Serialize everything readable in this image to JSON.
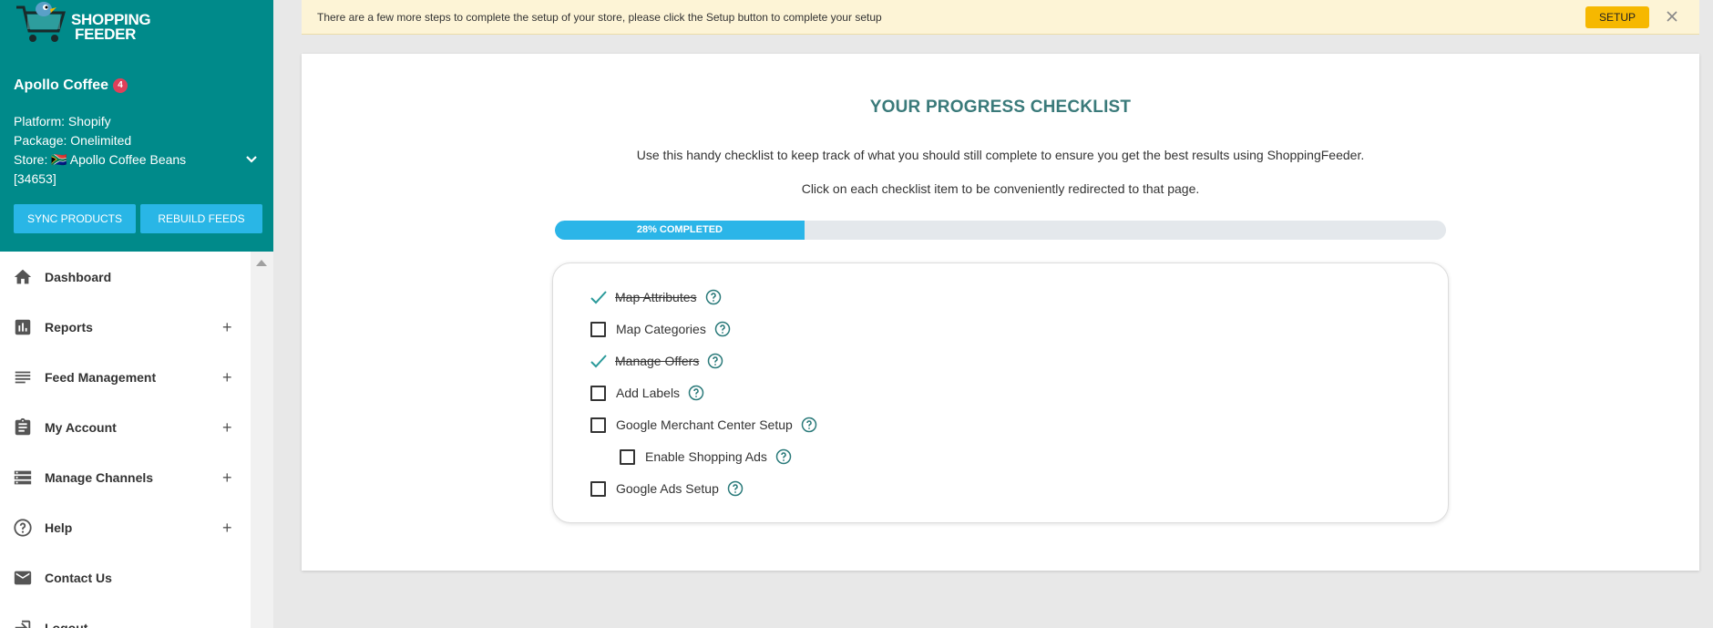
{
  "logo": {
    "line1": "SHOPPING",
    "line2": "FEEDER"
  },
  "store": {
    "name": "Apollo Coffee",
    "notifications": "4",
    "platform": "Platform: Shopify",
    "package": "Package: Onelimited",
    "store_line1": "Store: 🇿🇦 Apollo Coffee Beans",
    "store_line2": "[34653]"
  },
  "buttons": {
    "sync": "SYNC PRODUCTS",
    "rebuild": "REBUILD FEEDS"
  },
  "menu": [
    {
      "label": "Dashboard",
      "icon": "home-icon",
      "expandable": false
    },
    {
      "label": "Reports",
      "icon": "bar-chart-icon",
      "expandable": true
    },
    {
      "label": "Feed Management",
      "icon": "list-icon",
      "expandable": true
    },
    {
      "label": "My Account",
      "icon": "clipboard-icon",
      "expandable": true
    },
    {
      "label": "Manage Channels",
      "icon": "storage-icon",
      "expandable": true
    },
    {
      "label": "Help",
      "icon": "help-circle-icon",
      "expandable": true
    },
    {
      "label": "Contact Us",
      "icon": "mail-icon",
      "expandable": false
    },
    {
      "label": "Logout",
      "icon": "logout-icon",
      "expandable": false
    }
  ],
  "menu_plus": "+",
  "alert": {
    "text": "There are a few more steps to complete the setup of your store, please click the Setup button to complete your setup",
    "button": "SETUP"
  },
  "checklist": {
    "title": "YOUR PROGRESS CHECKLIST",
    "desc1": "Use this handy checklist to keep track of what you should still complete to ensure you get the best results using ShoppingFeeder.",
    "desc2": "Click on each checklist item to be conveniently redirected to that page.",
    "progress_label": "28% COMPLETED",
    "progress_percent": 28,
    "items": [
      {
        "label": "Map Attributes",
        "done": true
      },
      {
        "label": "Map Categories",
        "done": false
      },
      {
        "label": "Manage Offers",
        "done": true
      },
      {
        "label": "Add Labels",
        "done": false
      },
      {
        "label": "Google Merchant Center Setup",
        "done": false
      },
      {
        "label": "Enable Shopping Ads",
        "done": false
      },
      {
        "label": "Google Ads Setup",
        "done": false
      }
    ]
  },
  "colors": {
    "sidebar_bg": "#008a8a",
    "accent": "#29b6e6",
    "title": "#3a7a7a",
    "setup": "#f6b800"
  }
}
